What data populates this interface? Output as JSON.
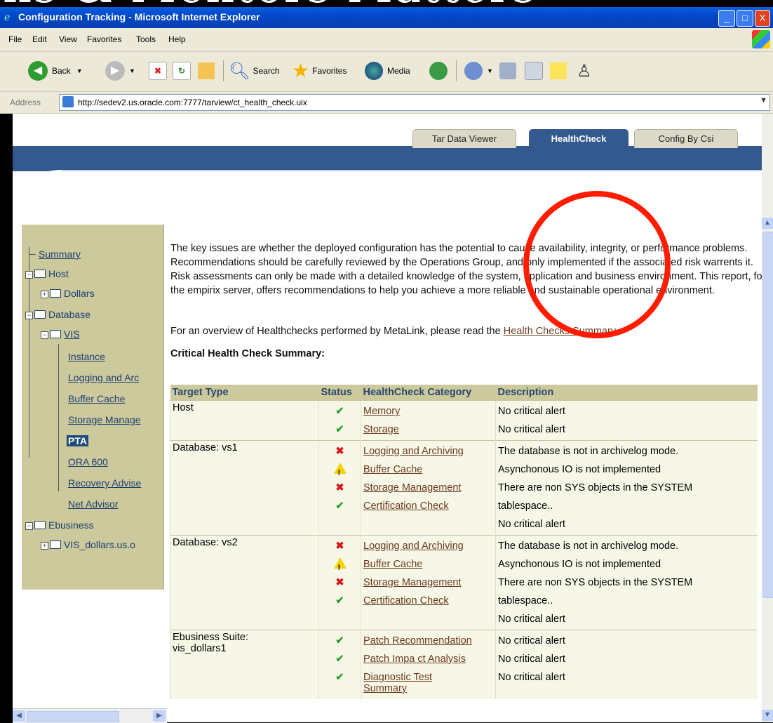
{
  "slide": {
    "title_fragment": "ns & Mentors Matters"
  },
  "window": {
    "title": "Configuration Tracking - Microsoft Internet Explorer",
    "buttons": {
      "minimize": "_",
      "maximize": "□",
      "close": "X"
    }
  },
  "menu": {
    "items": [
      "File",
      "Edit",
      "View",
      "Favorites",
      "Tools",
      "Help"
    ]
  },
  "toolbar": {
    "back_label": "Back",
    "search_label": "Search",
    "favorites_label": "Favorites",
    "media_label": "Media"
  },
  "address": {
    "label": "Address",
    "url": "http://sedev2.us.oracle.com:7777/tarview/ct_health_check.uix"
  },
  "tabs": [
    {
      "label": "Tar Data Viewer",
      "active": false
    },
    {
      "label": "HealthCheck",
      "active": true
    },
    {
      "label": "Config By Csi",
      "active": false
    }
  ],
  "nav": {
    "summary": "Summary",
    "host": "Host",
    "dollars": "Dollars",
    "database": "Database",
    "vis": "VIS",
    "instance": "Instance",
    "logging": "Logging and Arc",
    "buffer_cache": "Buffer Cache",
    "storage": "Storage Manage",
    "pta": "PTA",
    "ora600": "ORA 600",
    "recovery": "Recovery Advise",
    "net_advisor": "Net Advisor",
    "ebusiness": "Ebusiness",
    "vis_dollars": "VIS_dollars.us.o"
  },
  "content": {
    "intro": "The key issues are whether the deployed configuration has the potential to cause availability, integrity, or performance problems. Recommendations should be carefully reviewed by the Operations Group, and only implemented if the associated risk warrents it. Risk assessments can only be made with a detailed knowledge of the system, application and business environment. This report, for the empirix server, offers recommendations to help you achieve a more reliable and sustainable operational environment.",
    "overview_prefix": "For an overview of Healthchecks performed by MetaLink, please read the ",
    "overview_link": "Health Checks Summary.",
    "summary_title": "Critical Health Check Summary:"
  },
  "table": {
    "headers": [
      "Target Type",
      "Status",
      "HealthCheck Category",
      "Description"
    ],
    "groups": [
      {
        "target": "Host",
        "rows": [
          {
            "status": "ok",
            "category": "Memory",
            "description": "No critical alert"
          },
          {
            "status": "ok",
            "category": "Storage",
            "description": "No critical alert"
          }
        ]
      },
      {
        "target": "Database: vs1",
        "rows": [
          {
            "status": "error",
            "category": "Logging and Archiving",
            "description": "The database is not in archivelog mode."
          },
          {
            "status": "warning",
            "category": "Buffer Cache",
            "description": "Asynchonous IO is not implemented"
          },
          {
            "status": "error",
            "category": "Storage Management",
            "description": "There are non SYS objects in the SYSTEM"
          },
          {
            "status": "ok",
            "category": "Certification Check",
            "description": "tablespace.."
          }
        ],
        "extra_description": "No critical alert"
      },
      {
        "target": "Database: vs2",
        "rows": [
          {
            "status": "error",
            "category": "Logging and Archiving",
            "description": "The database is not in archivelog mode."
          },
          {
            "status": "warning",
            "category": "Buffer Cache",
            "description": "Asynchonous IO is not implemented"
          },
          {
            "status": "error",
            "category": "Storage Management",
            "description": "There are non SYS objects in the SYSTEM"
          },
          {
            "status": "ok",
            "category": "Certification Check",
            "description": "tablespace.."
          }
        ],
        "extra_description": "No critical alert"
      },
      {
        "target": "Ebusiness Suite:",
        "target2": "vis_dollars1",
        "rows": [
          {
            "status": "ok",
            "category": "Patch Recommendation",
            "description": "No critical alert"
          },
          {
            "status": "ok",
            "category": "Patch Impa ct Analysis",
            "description": "No critical alert"
          },
          {
            "status": "ok",
            "category": "Diagnostic Test",
            "description": "No critical alert"
          }
        ],
        "extra_category": "Summary"
      }
    ]
  },
  "colors": {
    "accent_band": "#34598f",
    "nav_panel": "#ccc99d",
    "link": "#6b3a1f",
    "annotation_circle": "#ff1c00"
  }
}
